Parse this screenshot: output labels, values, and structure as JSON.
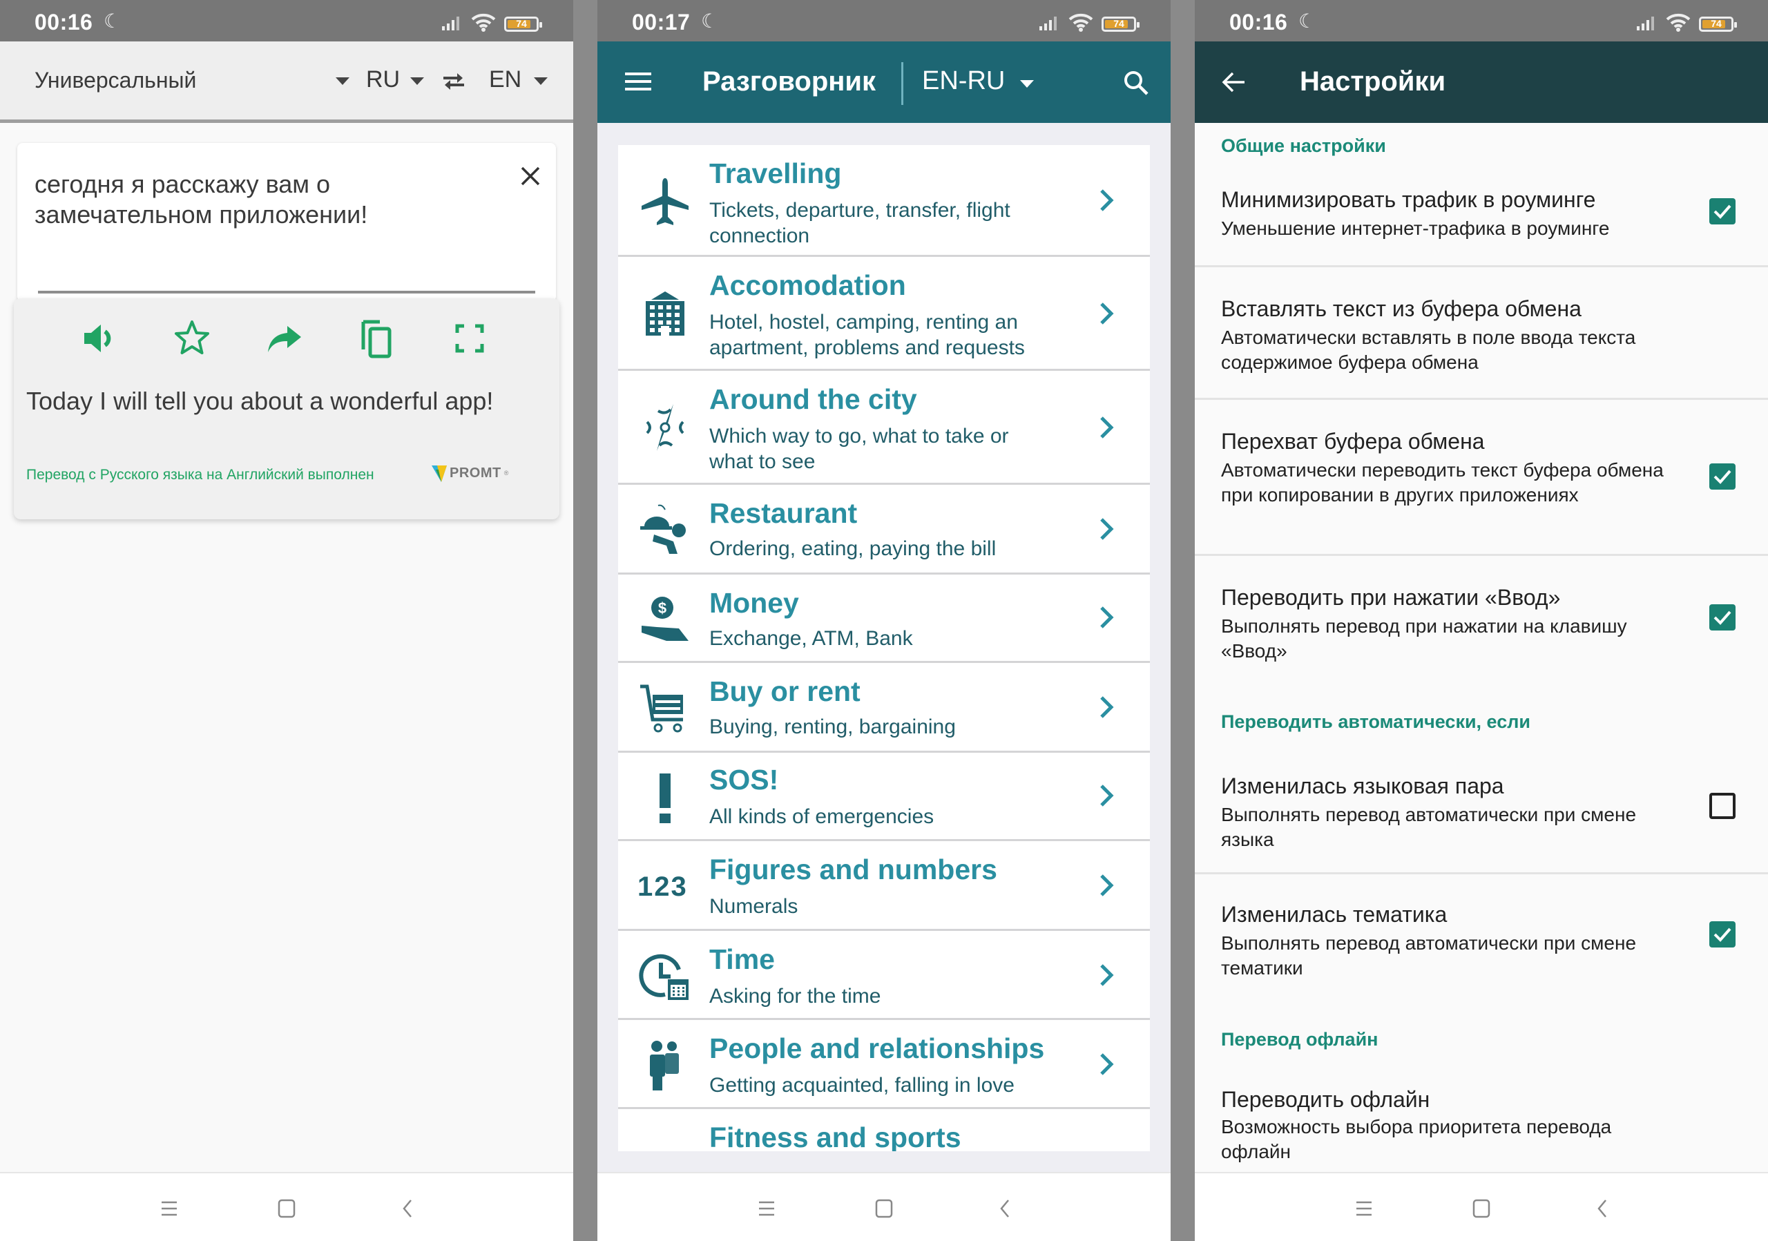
{
  "panels": {
    "translator": {
      "status": {
        "time": "00:16",
        "battery": "74"
      },
      "toolbar": {
        "topic": "Универсальный",
        "source_lang": "RU",
        "target_lang": "EN"
      },
      "input": {
        "text": "сегодня я расскажу вам о замечательном приложении!"
      },
      "output": {
        "actions": [
          "speak",
          "favorite",
          "share",
          "copy",
          "fullscreen"
        ],
        "text": "Today I will tell you about a wonderful app!",
        "footer": "Перевод с Русского языка на Английский выполнен",
        "brand": "PROMT"
      },
      "colors": {
        "accent": "#21a463"
      }
    },
    "phrasebook": {
      "status": {
        "time": "00:17",
        "battery": "74"
      },
      "header": {
        "title": "Разговорник",
        "pair": "EN-RU"
      },
      "colors": {
        "header": "#1d6673",
        "title": "#2a8fa1",
        "desc": "#215d69"
      },
      "categories": [
        {
          "icon": "airplane-icon",
          "title": "Travelling",
          "desc": "Tickets, departure, transfer, flight connection"
        },
        {
          "icon": "hotel-icon",
          "title": "Accomodation",
          "desc": "Hotel, hostel, camping, renting an apartment, problems and requests"
        },
        {
          "icon": "compass-icon",
          "title": "Around the city",
          "desc": "Which way to go, what to take or what to see"
        },
        {
          "icon": "waiter-icon",
          "title": "Restaurant",
          "desc": "Ordering, eating, paying the bill"
        },
        {
          "icon": "money-hand-icon",
          "title": "Money",
          "desc": "Exchange, ATM, Bank"
        },
        {
          "icon": "cart-icon",
          "title": "Buy or rent",
          "desc": "Buying, renting, bargaining"
        },
        {
          "icon": "exclamation-icon",
          "title": "SOS!",
          "desc": "All kinds of emergencies"
        },
        {
          "icon": "numbers-icon",
          "icon_text": "123",
          "title": "Figures and numbers",
          "desc": "Numerals"
        },
        {
          "icon": "clock-calendar-icon",
          "title": "Time",
          "desc": "Asking for the time"
        },
        {
          "icon": "people-icon",
          "title": "People and relationships",
          "desc": "Getting acquainted, falling in love"
        },
        {
          "icon": "fitness-icon",
          "title": "Fitness and sports",
          "desc": ""
        }
      ]
    },
    "settings": {
      "status": {
        "time": "00:16",
        "battery": "74"
      },
      "header": {
        "title": "Настройки"
      },
      "colors": {
        "header": "#1e4146",
        "section": "#1b8a78",
        "checkbox": "#1a8172"
      },
      "sections": [
        {
          "title": "Общие настройки"
        },
        {
          "title": "Переводить автоматически, если"
        },
        {
          "title": "Перевод офлайн"
        }
      ],
      "items": [
        {
          "title": "Минимизировать трафик в роуминге",
          "summary": "Уменьшение интернет-трафика в роуминге",
          "checkbox": true,
          "checked": true
        },
        {
          "title": "Вставлять текст из буфера обмена",
          "summary": "Автоматически вставлять в поле ввода текста содержимое буфера обмена",
          "checkbox": false,
          "checked": false
        },
        {
          "title": "Перехват буфера обмена",
          "summary": "Автоматически переводить текст буфера обмена при копировании в других приложениях",
          "checkbox": true,
          "checked": true
        },
        {
          "title": "Переводить при нажатии «Ввод»",
          "summary": "Выполнять перевод при нажатии на клавишу «Ввод»",
          "checkbox": true,
          "checked": true
        },
        {
          "title": "Изменилась языковая пара",
          "summary": "Выполнять перевод автоматически при смене языка",
          "checkbox": true,
          "checked": false
        },
        {
          "title": "Изменилась тематика",
          "summary": "Выполнять перевод автоматически при смене тематики",
          "checkbox": true,
          "checked": true
        },
        {
          "title": "Переводить офлайн",
          "summary": "Возможность выбора приоритета перевода офлайн",
          "checkbox": false,
          "checked": false
        }
      ]
    }
  }
}
